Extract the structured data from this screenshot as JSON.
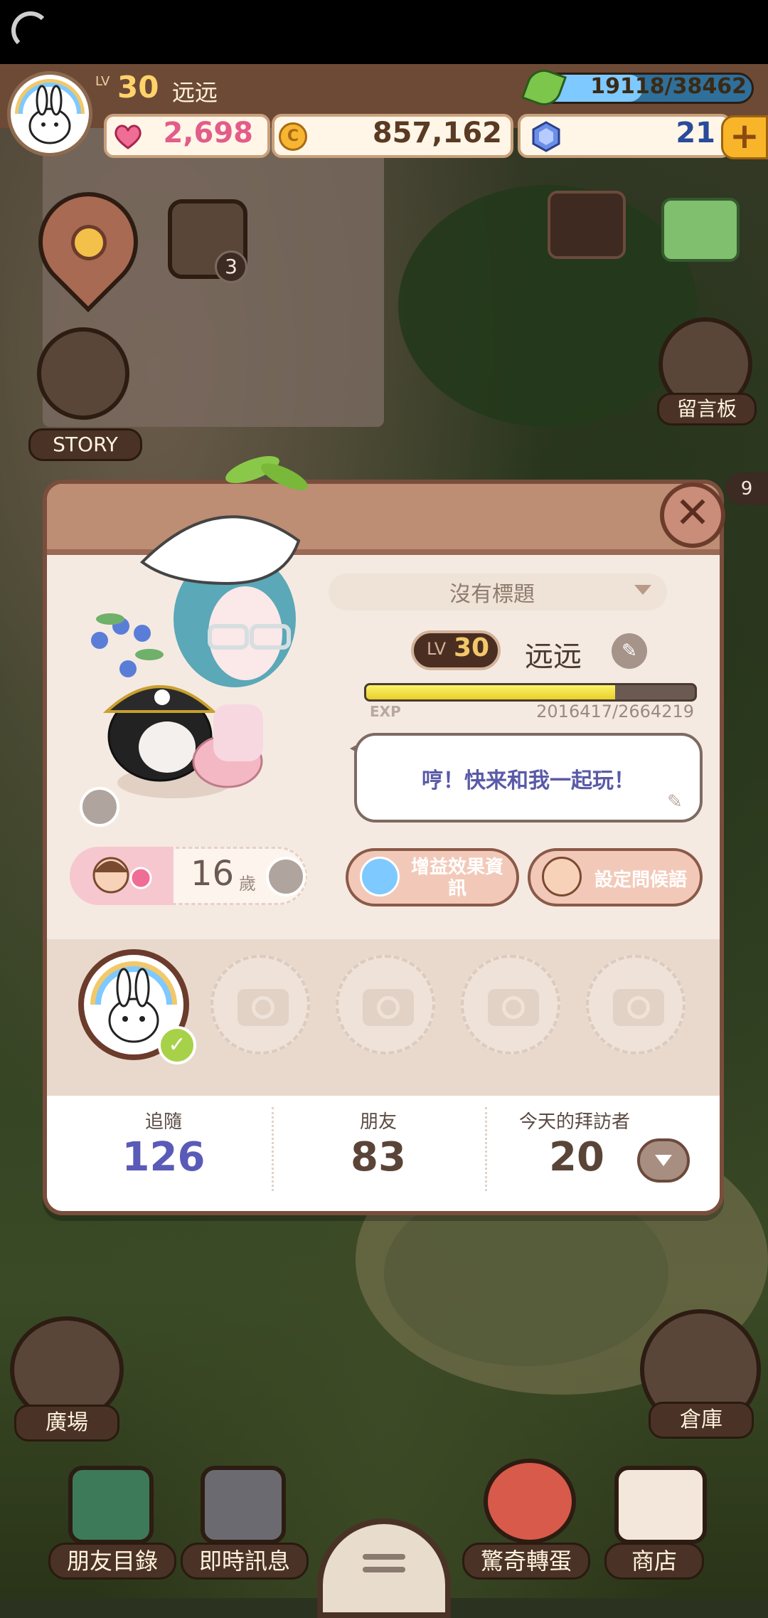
{
  "hud": {
    "level_prefix": "LV",
    "level": "30",
    "name": "远远",
    "exp": "19118/38462",
    "exp_fraction": 0.497,
    "hearts": "2,698",
    "coins": "857,162",
    "gems": "21",
    "plus": "+"
  },
  "scene": {
    "story_label": "STORY",
    "notification_count": "3",
    "message_board": "留言板",
    "side_count": "9",
    "plaza": "廣場",
    "warehouse": "倉庫"
  },
  "bottom_nav": {
    "friends_list": "朋友目錄",
    "instant_message": "即時訊息",
    "gacha": "驚奇轉蛋",
    "shop": "商店"
  },
  "profile": {
    "close": "✕",
    "title": "沒有標題",
    "level_prefix": "LV",
    "level": "30",
    "name": "远远",
    "exp_label": "EXP",
    "exp_value": "2016417/2664219",
    "exp_fraction": 0.757,
    "greeting": "哼！快来和我一起玩！",
    "age": "16",
    "age_unit": "歲",
    "buff_info_button": "增益效果資訊",
    "set_greeting_button": "設定問候語",
    "stats": {
      "following_label": "追隨",
      "following_value": "126",
      "friends_label": "朋友",
      "friends_value": "83",
      "visitors_label": "今天的拜訪者",
      "visitors_value": "20"
    }
  },
  "colors": {
    "following_value": "#5a5ab8",
    "stat_value": "#5a4438",
    "accent_pink": "#e35c8a",
    "coin_text": "#5a3a22"
  }
}
